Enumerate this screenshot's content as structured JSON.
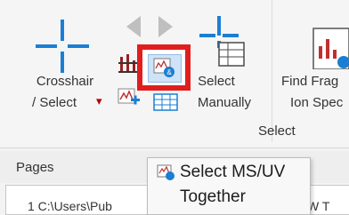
{
  "ribbon": {
    "crosshair": {
      "line1": "Crosshair",
      "line2": "/ Select",
      "dropdown_glyph": "▾",
      "icon": "crosshair-icon"
    },
    "select_ms_uv": {
      "icon": "select-ms-uv-icon",
      "highlighted": true
    },
    "select_manually": {
      "line1": "Select",
      "line2": "Manually",
      "icon": "select-manually-icon"
    },
    "find_fragment": {
      "line1": "Find Frag",
      "line2": "Ion Spec",
      "icon": "find-fragment-icon"
    },
    "group_label": "Select",
    "accent": "#1a7fd4",
    "highlight_color": "#e11e1e"
  },
  "pages": {
    "label": "Pages",
    "path_fragment": "1 C:\\Users\\Pub",
    "right_fragment": "W T"
  },
  "tooltip": {
    "line1": "Select MS/UV",
    "line2": "Together",
    "icon": "select-ms-uv-icon"
  }
}
